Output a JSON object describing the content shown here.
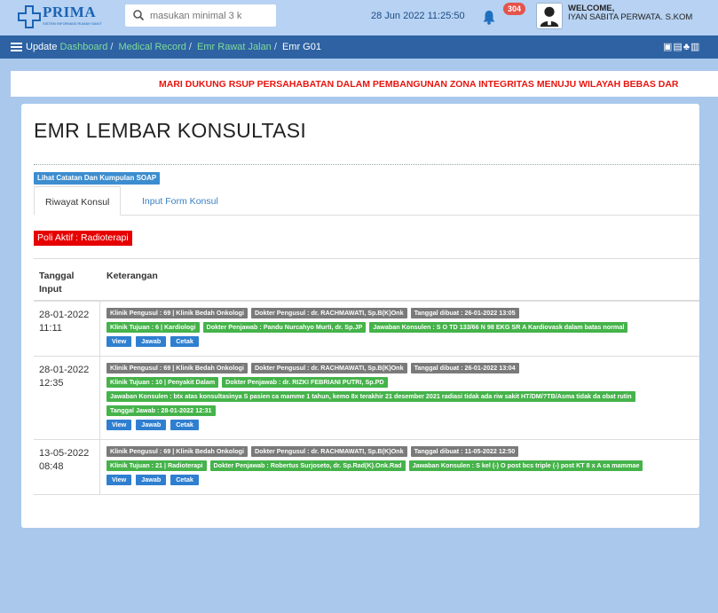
{
  "header": {
    "logo_text": "PRIMA",
    "logo_subtitle": "SISTEM INFORMASI RUMAH SAKIT",
    "search_placeholder": "masukan minimal 3 k",
    "datetime": "28 Jun 2022 11:25:50",
    "notification_count": "304",
    "welcome_label": "WELCOME,",
    "user_name": "IYAN SABITA PERWATA. S.KOM",
    "icons": [
      "cross-logo-icon",
      "search-icon",
      "bell-icon",
      "user-avatar-icon"
    ]
  },
  "nav": {
    "root": "Update",
    "crumbs": [
      "Dashboard",
      "Medical Record",
      "Emr Rawat Jalan"
    ],
    "current": "Emr G01",
    "right_icons": [
      "image-icon",
      "document-icon",
      "users-icon",
      "building-icon"
    ]
  },
  "announcement": "MARI DUKUNG RSUP PERSAHABATAN DALAM PEMBANGUNAN ZONA INTEGRITAS MENUJU WILAYAH BEBAS DAR",
  "page": {
    "title": "EMR LEMBAR KONSULTASI",
    "soap_button": "Lihat Catatan Dan Kumpulan SOAP",
    "tabs": [
      "Riwayat Konsul",
      "Input Form Konsul"
    ],
    "active_poli": "Poli Aktif : Radioterapi"
  },
  "table": {
    "headers": [
      "Tanggal Input",
      "Keterangan"
    ],
    "actions": [
      "View",
      "Jawab",
      "Cetak"
    ],
    "rows": [
      {
        "date": "28-01-2022",
        "time": "11:11",
        "lines": [
          [
            {
              "c": "gray",
              "t": "Klinik Pengusul : 69 | Klinik Bedah Onkologi"
            },
            {
              "c": "gray",
              "t": "Dokter Pengusul : dr. RACHMAWATI, Sp.B(K)Onk"
            },
            {
              "c": "gray",
              "t": "Tanggal dibuat : 26-01-2022 13:05"
            }
          ],
          [
            {
              "c": "green",
              "t": "Klinik Tujuan : 6 | Kardiologi"
            },
            {
              "c": "green",
              "t": "Dokter Penjawab : Pandu Nurcahyo Murti, dr. Sp.JP"
            },
            {
              "c": "green",
              "t": "Jawaban Konsulen : S O TD 133/66 N 98 EKG SR A Kardiovask dalam batas normal"
            }
          ]
        ]
      },
      {
        "date": "28-01-2022",
        "time": "12:35",
        "lines": [
          [
            {
              "c": "gray",
              "t": "Klinik Pengusul : 69 | Klinik Bedah Onkologi"
            },
            {
              "c": "gray",
              "t": "Dokter Pengusul : dr. RACHMAWATI, Sp.B(K)Onk"
            },
            {
              "c": "gray",
              "t": "Tanggal dibuat : 26-01-2022 13:04"
            }
          ],
          [
            {
              "c": "green",
              "t": "Klinik Tujuan : 10 | Penyakit Dalam"
            },
            {
              "c": "green",
              "t": "Dokter Penjawab : dr. RIZKI FEBRIANI PUTRI, Sp.PD"
            }
          ],
          [
            {
              "c": "green",
              "t": "Jawaban Konsulen : btx atas konsultasinya S pasien ca mamme 1 tahun, kemo 8x terakhir 21 desember 2021 radiasi tidak ada riw sakit HT/DM/?TB/Asma tidak da obat rutin"
            }
          ],
          [
            {
              "c": "green",
              "t": "Tanggal Jawab : 28-01-2022 12:31"
            }
          ]
        ]
      },
      {
        "date": "13-05-2022",
        "time": "08:48",
        "lines": [
          [
            {
              "c": "gray",
              "t": "Klinik Pengusul : 69 | Klinik Bedah Onkologi"
            },
            {
              "c": "gray",
              "t": "Dokter Pengusul : dr. RACHMAWATI, Sp.B(K)Onk"
            },
            {
              "c": "gray",
              "t": "Tanggal dibuat : 11-05-2022 12:50"
            }
          ],
          [
            {
              "c": "green",
              "t": "Klinik Tujuan : 21 | Radioterapi"
            },
            {
              "c": "green",
              "t": "Dokter Penjawab : Robertus Surjoseto, dr. Sp.Rad(K).Onk.Rad"
            },
            {
              "c": "green",
              "t": "Jawaban Konsulen : S kel (-) O post bcs triple (-) post KT 8 x A ca mammae"
            }
          ]
        ]
      }
    ]
  }
}
